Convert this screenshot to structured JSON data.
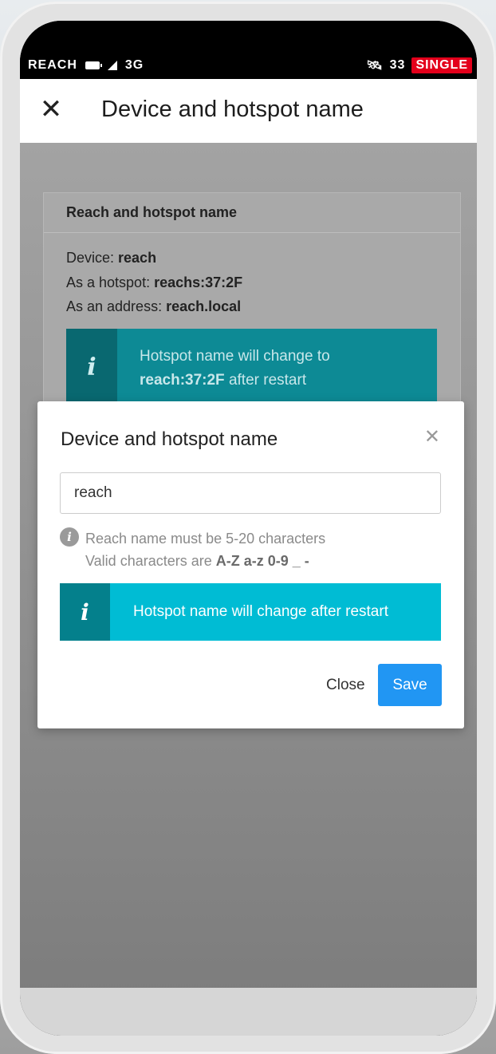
{
  "status_bar": {
    "carrier": "REACH",
    "network": "3G",
    "satellites": "33",
    "solution": "SINGLE",
    "colors": {
      "solution_bg": "#e3001b"
    }
  },
  "app_bar": {
    "title": "Device and hotspot name"
  },
  "card": {
    "header": "Reach and hotspot name",
    "device_label": "Device: ",
    "device_value": "reach",
    "hotspot_label": "As a hotspot: ",
    "hotspot_value": "reachs:37:2F",
    "address_label": "As an address: ",
    "address_value": "reach.local",
    "info_line1": "Hotspot name will change to",
    "info_bold": "reach:37:2F",
    "info_tail": " after restart"
  },
  "modal": {
    "title": "Device and hotspot name",
    "input_value": "reach",
    "hint_line1": "Reach name must be 5-20 characters",
    "hint_line2_prefix": "Valid characters are ",
    "hint_line2_bold": "A-Z a-z 0-9 _ -",
    "info_text": "Hotspot name will change after restart",
    "close_label": "Close",
    "save_label": "Save",
    "colors": {
      "info_bg": "#00bcd4",
      "save_bg": "#2196f3"
    }
  }
}
